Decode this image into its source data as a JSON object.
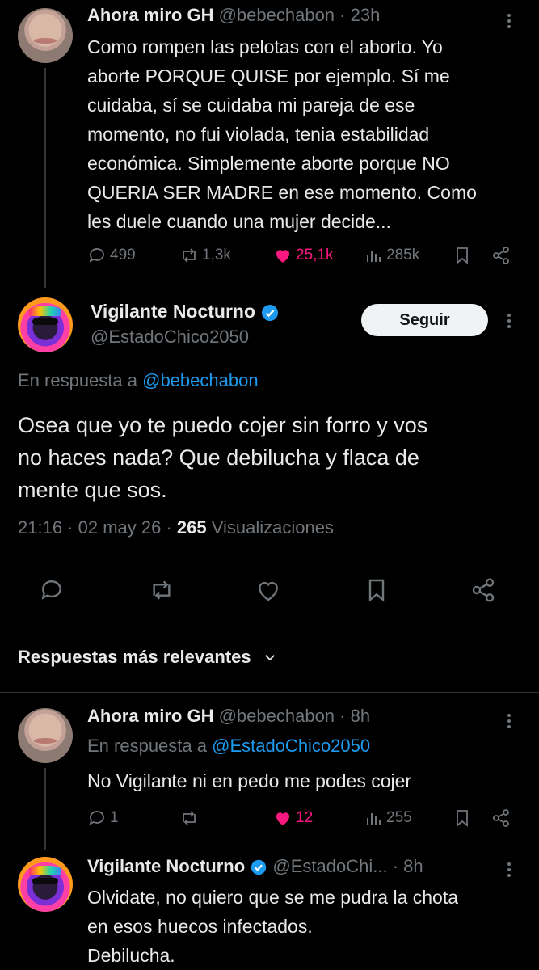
{
  "tweet1": {
    "name": "Ahora miro GH",
    "handle": "@bebechabon",
    "time": "23h",
    "text_lines": [
      "Como rompen las pelotas con el aborto. Yo",
      "aborte PORQUE QUISE por ejemplo. Sí me",
      "cuidaba, sí se cuidaba mi pareja de ese",
      "momento, no fui violada, tenia estabilidad",
      "económica. Simplemente aborte porque NO",
      "QUERIA SER MADRE en ese momento. Como",
      "les duele cuando una mujer decide..."
    ],
    "replies": "499",
    "retweets": "1,3k",
    "likes": "25,1k",
    "views": "285k"
  },
  "main": {
    "name": "Vigilante Nocturno",
    "handle": "@EstadoChico2050",
    "follow_label": "Seguir",
    "reply_prefix": "En respuesta a",
    "reply_to": "@bebechabon",
    "text_lines": [
      "Osea que yo te puedo cojer sin forro y vos",
      "no haces nada? Que debilucha y flaca de",
      "mente que sos."
    ],
    "time": "21:16",
    "date": "02 may 26",
    "views_count": "265",
    "views_label": "Visualizaciones"
  },
  "sort_label": "Respuestas más relevantes",
  "reply1": {
    "name": "Ahora miro GH",
    "handle": "@bebechabon",
    "time": "8h",
    "reply_prefix": "En respuesta a",
    "reply_to": "@EstadoChico2050",
    "text": "No Vigilante ni en pedo me podes cojer",
    "replies": "1",
    "likes": "12",
    "views": "255"
  },
  "reply2": {
    "name": "Vigilante Nocturno",
    "handle": "@EstadoChi...",
    "time": "8h",
    "text_lines": [
      "Olvidate,  no quiero que se me pudra la chota",
      "en esos huecos infectados.",
      "Debilucha."
    ]
  },
  "colors": {
    "background": "#000000",
    "text": "#e7e9ea",
    "muted": "#71767b",
    "link": "#1d9bf0",
    "like": "#f91880",
    "verified": "#1d9bf0"
  }
}
